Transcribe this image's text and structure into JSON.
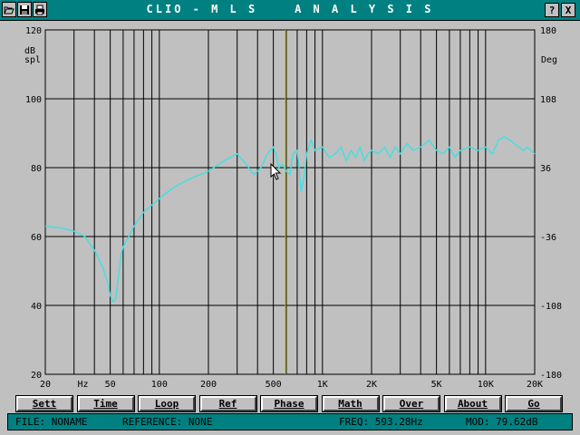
{
  "window": {
    "title": "CLIO - M L S    A N A L Y S I S",
    "help_label": "?",
    "close_label": "X"
  },
  "colors": {
    "titlebar": "#008080",
    "plot_bg": "#c0c0c0",
    "trace": "#40e0e0",
    "cursor": "#c8c800",
    "grid": "#000000"
  },
  "axes": {
    "left_unit_1": "dB",
    "left_unit_2": "spl",
    "right_unit": "Deg",
    "y_ticks": [
      "120",
      "100",
      "80",
      "60",
      "40",
      "20"
    ],
    "phase_ticks": [
      "180",
      "108",
      "36",
      "-36",
      "-108",
      "-180"
    ],
    "x_ticks": [
      "20",
      "Hz",
      "50",
      "100",
      "200",
      "500",
      "1K",
      "2K",
      "5K",
      "10K",
      "20K"
    ]
  },
  "chart_data": {
    "type": "line",
    "x_scale": "log",
    "xlim": [
      20,
      20000
    ],
    "ylim": [
      20,
      120
    ],
    "y2lim": [
      -180,
      180
    ],
    "xlabel": "Hz",
    "ylabel": "dB spl",
    "y2label": "Deg",
    "grid": true,
    "cursor_freq": 593.28,
    "series": [
      {
        "x": [
          20,
          25,
          30,
          35,
          40,
          45,
          48,
          50,
          52,
          54,
          56,
          58,
          60,
          65,
          70,
          80,
          100,
          120,
          150,
          200,
          250,
          300,
          340,
          380,
          420,
          460,
          500,
          520,
          540,
          570,
          600,
          630,
          660,
          700,
          720,
          740,
          770,
          800,
          850,
          900,
          1000,
          1100,
          1200,
          1300,
          1400,
          1500,
          1600,
          1700,
          1800,
          1900,
          2000,
          2200,
          2400,
          2600,
          2800,
          3000,
          3300,
          3600,
          4000,
          4500,
          5000,
          5500,
          6000,
          6500,
          7000,
          8000,
          9000,
          10000,
          11000,
          12000,
          13000,
          14000,
          15000,
          16000,
          17000,
          18000,
          19000,
          20000
        ],
        "values": [
          63,
          62.5,
          61.5,
          60,
          56,
          51,
          47,
          43,
          41,
          42,
          48,
          54,
          57,
          60,
          63,
          67,
          71,
          74,
          76.5,
          79,
          82,
          84,
          81,
          78,
          80,
          84,
          86,
          84,
          80,
          81,
          79,
          78,
          84,
          85,
          80,
          73,
          77,
          84,
          88,
          85,
          86,
          83,
          84,
          86,
          82,
          85,
          83,
          86,
          82,
          84,
          85,
          84,
          86,
          83,
          86,
          84,
          87,
          85,
          86,
          88,
          85,
          84,
          86,
          83,
          85,
          86,
          85,
          86,
          84,
          88,
          89,
          88,
          87,
          86,
          85,
          86,
          85,
          84
        ]
      }
    ]
  },
  "buttons": [
    "Sett",
    "Time",
    "Loop",
    "Ref",
    "Phase",
    "Math",
    "Over",
    "About",
    "Go"
  ],
  "status": {
    "file": "FILE: NONAME",
    "reference": "REFERENCE: NONE",
    "freq": "FREQ: 593.28Hz",
    "mod": "MOD: 79.62dB"
  }
}
